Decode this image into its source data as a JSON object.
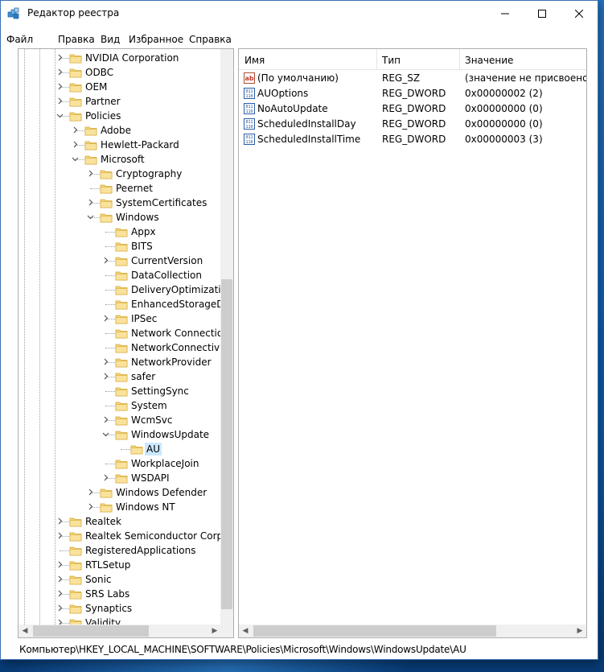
{
  "window": {
    "title": "Редактор реестра"
  },
  "menu": [
    "Файл",
    "Правка",
    "Вид",
    "Избранное",
    "Справка"
  ],
  "tree": [
    {
      "label": "NVIDIA Corporation",
      "expander": "collapsed"
    },
    {
      "label": "ODBC",
      "expander": "collapsed"
    },
    {
      "label": "OEM",
      "expander": "collapsed"
    },
    {
      "label": "Partner",
      "expander": "collapsed"
    },
    {
      "label": "Policies",
      "expander": "expanded"
    },
    {
      "label": "Adobe",
      "expander": "collapsed"
    },
    {
      "label": "Hewlett-Packard",
      "expander": "collapsed"
    },
    {
      "label": "Microsoft",
      "expander": "expanded"
    },
    {
      "label": "Cryptography",
      "expander": "collapsed"
    },
    {
      "label": "Peernet",
      "expander": "none"
    },
    {
      "label": "SystemCertificates",
      "expander": "collapsed"
    },
    {
      "label": "Windows",
      "expander": "expanded"
    },
    {
      "label": "Appx",
      "expander": "none"
    },
    {
      "label": "BITS",
      "expander": "none"
    },
    {
      "label": "CurrentVersion",
      "expander": "collapsed"
    },
    {
      "label": "DataCollection",
      "expander": "none"
    },
    {
      "label": "DeliveryOptimization",
      "expander": "none"
    },
    {
      "label": "EnhancedStorageDevices",
      "expander": "none"
    },
    {
      "label": "IPSec",
      "expander": "collapsed"
    },
    {
      "label": "Network Connections",
      "expander": "none"
    },
    {
      "label": "NetworkConnectivityStatusIndicator",
      "expander": "none"
    },
    {
      "label": "NetworkProvider",
      "expander": "collapsed"
    },
    {
      "label": "safer",
      "expander": "collapsed"
    },
    {
      "label": "SettingSync",
      "expander": "none"
    },
    {
      "label": "System",
      "expander": "none"
    },
    {
      "label": "WcmSvc",
      "expander": "collapsed"
    },
    {
      "label": "WindowsUpdate",
      "expander": "expanded"
    },
    {
      "label": "AU",
      "expander": "none",
      "selected": true
    },
    {
      "label": "WorkplaceJoin",
      "expander": "none"
    },
    {
      "label": "WSDAPI",
      "expander": "collapsed"
    },
    {
      "label": "Windows Defender",
      "expander": "collapsed"
    },
    {
      "label": "Windows NT",
      "expander": "collapsed"
    },
    {
      "label": "Realtek",
      "expander": "collapsed"
    },
    {
      "label": "Realtek Semiconductor Corp.",
      "expander": "collapsed"
    },
    {
      "label": "RegisteredApplications",
      "expander": "none"
    },
    {
      "label": "RTLSetup",
      "expander": "collapsed"
    },
    {
      "label": "Sonic",
      "expander": "collapsed"
    },
    {
      "label": "SRS Labs",
      "expander": "collapsed"
    },
    {
      "label": "Synaptics",
      "expander": "collapsed"
    },
    {
      "label": "Validity",
      "expander": "collapsed"
    }
  ],
  "list": {
    "columns": [
      "Имя",
      "Тип",
      "Значение"
    ],
    "rows": [
      {
        "icon": "string-value-icon",
        "name": "(По умолчанию)",
        "type": "REG_SZ",
        "value": "(значение не присвоено)"
      },
      {
        "icon": "binary-value-icon",
        "name": "AUOptions",
        "type": "REG_DWORD",
        "value": "0x00000002 (2)"
      },
      {
        "icon": "binary-value-icon",
        "name": "NoAutoUpdate",
        "type": "REG_DWORD",
        "value": "0x00000000 (0)"
      },
      {
        "icon": "binary-value-icon",
        "name": "ScheduledInstallDay",
        "type": "REG_DWORD",
        "value": "0x00000000 (0)"
      },
      {
        "icon": "binary-value-icon",
        "name": "ScheduledInstallTime",
        "type": "REG_DWORD",
        "value": "0x00000003 (3)"
      }
    ]
  },
  "status": "Компьютер\\HKEY_LOCAL_MACHINE\\SOFTWARE\\Policies\\Microsoft\\Windows\\WindowsUpdate\\AU",
  "colors": {
    "selection": "#cce8ff",
    "folder": "#f5d67a",
    "accent_border": "#3b6fb3"
  }
}
